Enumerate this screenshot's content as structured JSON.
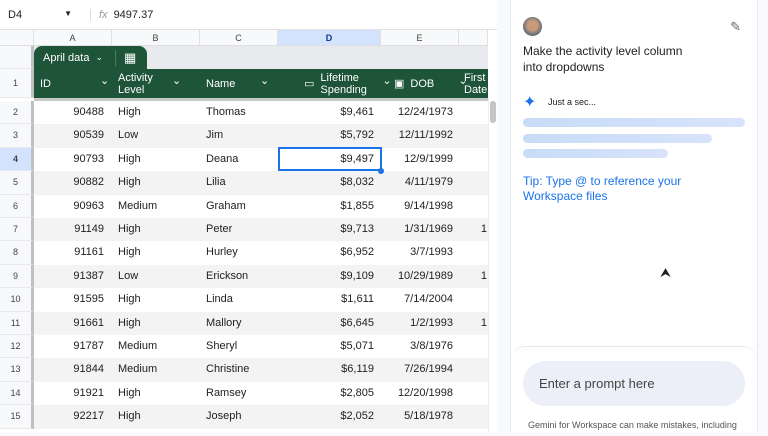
{
  "formula_bar": {
    "cell_ref": "D4",
    "fx": "fx",
    "value": "9497.37"
  },
  "columns": [
    "A",
    "B",
    "C",
    "D",
    "E"
  ],
  "selected_column": "D",
  "table": {
    "name": "April data",
    "headers": [
      "ID",
      "Activity Level",
      "Name",
      "Lifetime Spending",
      "DOB",
      "First Date"
    ],
    "rows": [
      [
        "2",
        "90488",
        "High",
        "Thomas",
        "$9,461",
        "12/24/1973",
        ""
      ],
      [
        "3",
        "90539",
        "Low",
        "Jim",
        "$5,792",
        "12/11/1992",
        ""
      ],
      [
        "4",
        "90793",
        "High",
        "Deana",
        "$9,497",
        "12/9/1999",
        ""
      ],
      [
        "5",
        "90882",
        "High",
        "Lilia",
        "$8,032",
        "4/11/1979",
        ""
      ],
      [
        "6",
        "90963",
        "Medium",
        "Graham",
        "$1,855",
        "9/14/1998",
        ""
      ],
      [
        "7",
        "91149",
        "High",
        "Peter",
        "$9,713",
        "1/31/1969",
        "1"
      ],
      [
        "8",
        "91161",
        "High",
        "Hurley",
        "$6,952",
        "3/7/1993",
        ""
      ],
      [
        "9",
        "91387",
        "Low",
        "Erickson",
        "$9,109",
        "10/29/1989",
        "1"
      ],
      [
        "10",
        "91595",
        "High",
        "Linda",
        "$1,611",
        "7/14/2004",
        ""
      ],
      [
        "11",
        "91661",
        "High",
        "Mallory",
        "$6,645",
        "1/2/1993",
        "1"
      ],
      [
        "12",
        "91787",
        "Medium",
        "Sheryl",
        "$5,071",
        "3/8/1976",
        ""
      ],
      [
        "13",
        "91844",
        "Medium",
        "Christine",
        "$6,119",
        "7/26/1994",
        ""
      ],
      [
        "14",
        "91921",
        "High",
        "Ramsey",
        "$2,805",
        "12/20/1998",
        ""
      ],
      [
        "15",
        "92217",
        "High",
        "Joseph",
        "$2,052",
        "5/18/1978",
        ""
      ]
    ]
  },
  "header_row_number": "1",
  "panel": {
    "user_prompt": "Make the activity level column into dropdowns",
    "status": "Just a sec...",
    "tip": "Tip: Type @ to reference your Workspace files",
    "input_placeholder": "Enter a prompt here",
    "disclaimer": "Gemini for Workspace can make mistakes, including"
  },
  "colors": {
    "table_header": "#1e5438",
    "selection": "#1a73e8",
    "tip": "#1a73e8"
  }
}
